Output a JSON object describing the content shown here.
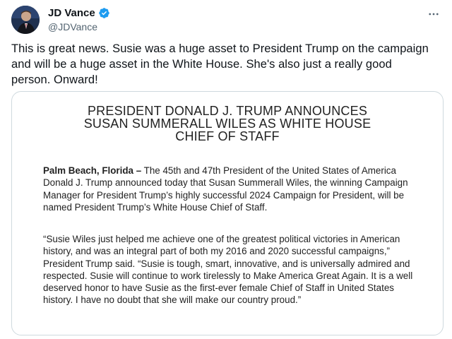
{
  "tweet": {
    "display_name": "JD Vance",
    "handle": "@JDVance",
    "verified_icon": "verified-badge-icon",
    "more_icon": "more-options-icon",
    "text": "This is great news. Susie was a huge asset to President Trump on the campaign and will be a huge asset in the White House. She's also just a really good person. Onward!"
  },
  "document": {
    "title_lines": [
      "PRESIDENT DONALD J. TRUMP ANNOUNCES",
      "SUSAN SUMMERALL WILES AS WHITE HOUSE",
      "CHIEF OF STAFF"
    ],
    "dateline": "Palm Beach, Florida –",
    "paragraph1": " The 45th and 47th President of the United States of America Donald J. Trump announced today that Susan Summerall Wiles, the winning Campaign Manager for President Trump’s highly successful 2024 Campaign for President, will be named President Trump’s White House Chief of Staff.",
    "paragraph2": "“Susie Wiles just helped me achieve one of the greatest political victories in American history, and was an integral part of both my 2016 and 2020 successful campaigns,” President Trump said. “Susie is tough, smart, innovative, and is universally admired and respected. Susie will continue to work tirelessly to Make America Great Again. It is a well deserved honor to have Susie as the first-ever female Chief of Staff in United States history. I have no doubt that she will make our country proud.”"
  },
  "colors": {
    "verified": "#1d9bf0",
    "secondary_text": "#536471",
    "border": "#cfd9de"
  }
}
